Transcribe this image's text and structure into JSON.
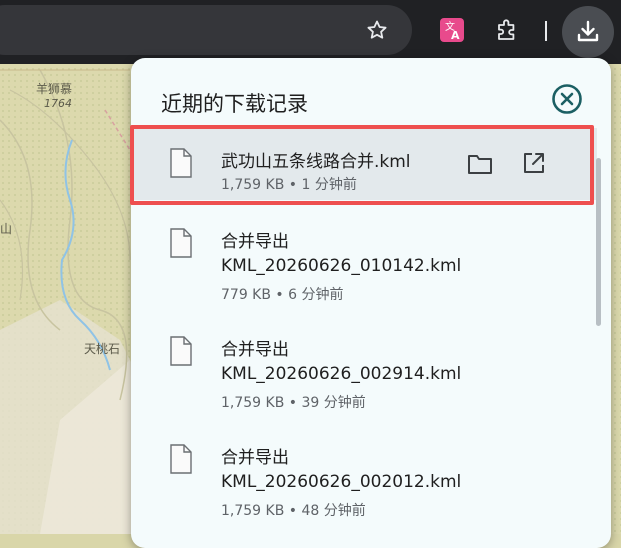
{
  "map": {
    "labels": [
      "羊狮慕",
      "1764",
      "山",
      "天桃石"
    ]
  },
  "toolbar": {
    "icons": [
      "star-icon",
      "translate-icon",
      "extensions-icon",
      "download-icon"
    ]
  },
  "panel": {
    "title": "近期的下载记录",
    "items": [
      {
        "name": "武功山五条线路合并.kml",
        "meta": "1,759 KB • 1 分钟前"
      },
      {
        "name": "合并导出",
        "name2": "KML_20260626_010142.kml",
        "meta": "779 KB • 6 分钟前"
      },
      {
        "name": "合并导出",
        "name2": "KML_20260626_002914.kml",
        "meta": "1,759 KB • 39 分钟前"
      },
      {
        "name": "合并导出",
        "name2": "KML_20260626_002012.kml",
        "meta": "1,759 KB • 48 分钟前"
      }
    ]
  },
  "colors": {
    "toolbar_bg": "#202124",
    "panel_bg": "#f4fbfc",
    "highlight_border": "#ee4f4f",
    "close_icon": "#1b5f63",
    "translate_accent": "#e84a8c"
  }
}
